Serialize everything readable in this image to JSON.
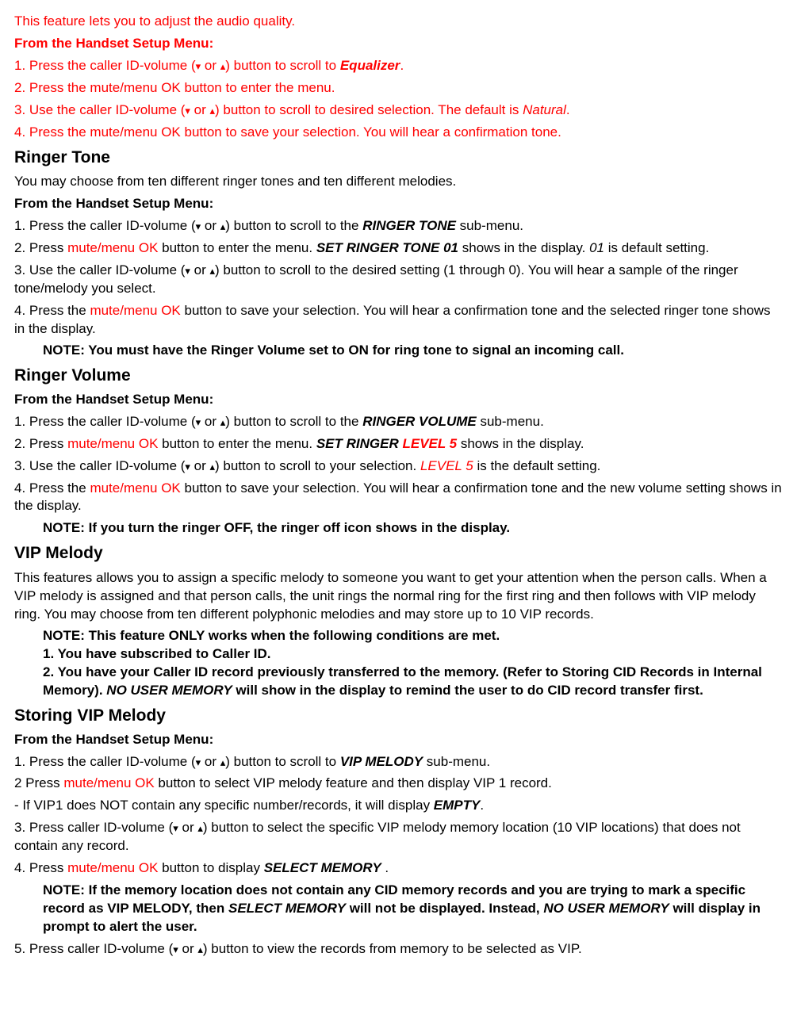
{
  "equalizer": {
    "intro": "This feature lets you to adjust the audio quality.",
    "menu_heading": "From the Handset Setup Menu:",
    "step1_a": "1. Press the caller ID-volume (",
    "step1_b": " or ",
    "step1_c": ") button to scroll to ",
    "step1_target": "Equalizer",
    "step1_end": ".",
    "step2": "2. Press the mute/menu OK button to enter the menu.",
    "step3_a": "3. Use the caller ID-volume (",
    "step3_b": "  or ",
    "step3_c": ") button to scroll to desired selection. The default is ",
    "step3_default": "Natural",
    "step3_end": ".",
    "step4": "4. Press the mute/menu OK button to save your selection. You will hear a confirmation tone."
  },
  "ringer_tone": {
    "heading": "Ringer Tone",
    "intro": "You may choose from ten different ringer tones and ten different melodies.",
    "menu_heading": "From the Handset Setup Menu:",
    "step1_a": "1. Press the caller ID-volume (",
    "step1_b": " or ",
    "step1_c": ") button to scroll to the ",
    "step1_target": "RINGER TONE",
    "step1_end": " sub-menu.",
    "step2_a": "2. Press ",
    "step2_btn": "mute/menu OK",
    "step2_b": " button to enter the menu. ",
    "step2_display": "SET RINGER TONE 01",
    "step2_c": " shows in the display. ",
    "step2_default": "01",
    "step2_d": " is default setting.",
    "step3_a": "3. Use the caller ID-volume (",
    "step3_b": "  or ",
    "step3_c": ") button to scroll to the desired setting (1 through 0). You will hear a sample of the ringer tone/melody you select.",
    "step4_a": "4. Press the ",
    "step4_btn": "mute/menu OK",
    "step4_b": " button to save your selection. You will hear a confirmation tone and the selected ringer tone shows in the display.",
    "note": "NOTE: You must have the Ringer Volume set to ON for ring tone to signal an incoming call."
  },
  "ringer_volume": {
    "heading": "Ringer Volume",
    "menu_heading": "From the Handset Setup Menu:",
    "step1_a": "1. Press the caller ID-volume (",
    "step1_b": " or ",
    "step1_c": ") button to scroll to the ",
    "step1_target": "RINGER VOLUME",
    "step1_end": " sub-menu.",
    "step2_a": "2. Press ",
    "step2_btn": "mute/menu OK",
    "step2_b": " button to enter the menu. ",
    "step2_display_a": "SET RINGER ",
    "step2_display_b": "LEVEL 5",
    "step2_c": " shows in the display.",
    "step3_a": "3. Use the caller ID-volume (",
    "step3_b": "  or ",
    "step3_c": ") button to scroll to your selection. ",
    "step3_default": "LEVEL 5",
    "step3_d": " is the default setting.",
    "step4_a": "4. Press the ",
    "step4_btn": "mute/menu OK",
    "step4_b": " button to save your selection. You will hear a confirmation tone and the new volume setting shows in the display.",
    "note": "NOTE: If you turn the ringer OFF, the ringer off icon shows in the display."
  },
  "vip_melody": {
    "heading": "VIP Melody",
    "intro": "This features allows you to assign a specific melody to someone you want to get your attention when the person calls. When a VIP melody is assigned and that person calls, the unit rings the normal ring for the first ring and then follows with VIP melody ring. You may choose from ten different polyphonic melodies and may store up to 10 VIP records.",
    "note_intro": "NOTE: This feature ONLY works when the following conditions are met.",
    "note_1": "1. You have subscribed to Caller ID.",
    "note_2a": "2. You have your Caller ID record previously transferred to the memory. (Refer to Storing CID Records in Internal Memory). ",
    "note_2b": "NO USER MEMORY",
    "note_2c": " will show in the display to remind the user to do CID record transfer first."
  },
  "storing_vip": {
    "heading": "Storing VIP Melody",
    "menu_heading": "From the Handset Setup Menu:",
    "step1_a": "1. Press the caller ID-volume (",
    "step1_b": " or ",
    "step1_c": ") button to scroll to ",
    "step1_target": "VIP MELODY",
    "step1_end": " sub-menu.",
    "step2_a": "2 Press ",
    "step2_btn": "mute/menu OK",
    "step2_b": " button to select VIP melody feature and then display VIP 1 record.",
    "dash_a": "- If VIP1 does NOT contain any specific number/records, it will display ",
    "dash_b": "EMPTY",
    "dash_c": ".",
    "step3_a": "3. Press caller ID-volume (",
    "step3_b": " or ",
    "step3_c": ") button to select the specific VIP melody memory location (10 VIP locations) that does not contain any record.",
    "step4_a": "4. Press ",
    "step4_btn": "mute/menu OK",
    "step4_b": " button to display ",
    "step4_display": "SELECT MEMORY",
    "step4_c": " .",
    "note_a": "NOTE: If the memory location does not contain any CID memory records and you are trying to mark a specific record as VIP MELODY, then ",
    "note_b": "SELECT MEMORY",
    "note_c": " will not be displayed. Instead, ",
    "note_d": "NO USER MEMORY",
    "note_e": " will display in prompt to alert the user.",
    "step5_a": "5. Press caller ID-volume (",
    "step5_b": " or ",
    "step5_c": ") button to view the records from memory to be selected as VIP."
  }
}
